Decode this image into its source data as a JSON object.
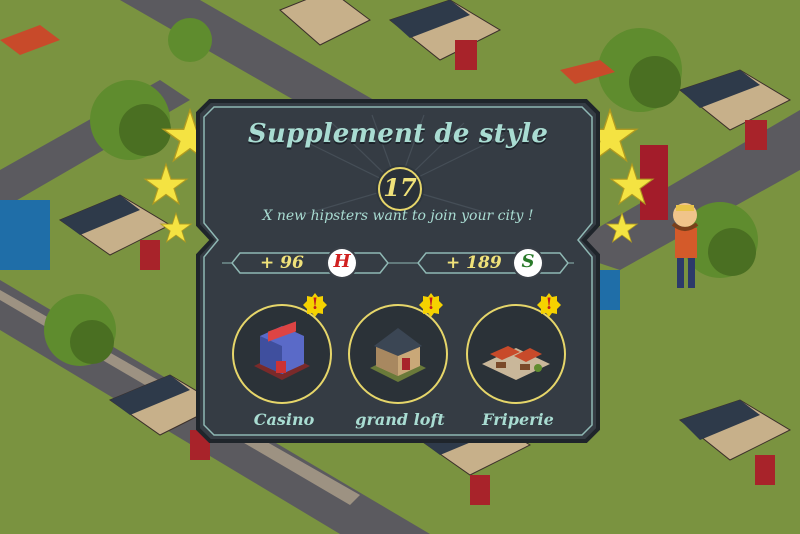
{
  "popup": {
    "title": "Supplement de style",
    "level": "17",
    "subtitle": "X new hipsters want to join your city !",
    "rewards": [
      {
        "text": "+ 96",
        "icon_name": "hipster-currency-icon",
        "icon_letter": "H",
        "icon_color": "#d12020"
      },
      {
        "text": "+ 189",
        "icon_name": "money-currency-icon",
        "icon_letter": "S",
        "icon_color": "#2a7a2a"
      }
    ],
    "buildings": [
      {
        "label": "Casino",
        "alert": "!"
      },
      {
        "label": "grand loft",
        "alert": "!"
      },
      {
        "label": "Friperie",
        "alert": "!"
      }
    ]
  },
  "colors": {
    "panel_bg": "#353c44",
    "panel_border": "#8fb8b4",
    "title_text": "#a9dcd2",
    "accent_yellow": "#f0e27a",
    "star": "#f4e342",
    "alert_bg": "#f5d200",
    "alert_text": "#c21d1d"
  }
}
